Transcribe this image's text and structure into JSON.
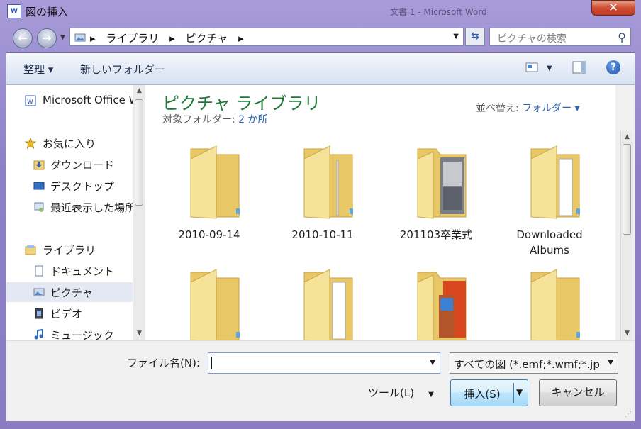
{
  "window": {
    "title": "図の挿入",
    "background_title": "文書 1 - Microsoft Word",
    "close_label": "✕"
  },
  "address": {
    "crumbs": [
      "ライブラリ",
      "ピクチャ"
    ],
    "search_placeholder": "ピクチャの検索"
  },
  "toolbar": {
    "organize_label": "整理 ▾",
    "new_folder_label": "新しいフォルダー"
  },
  "nav": {
    "items": [
      {
        "label": "Microsoft Office W",
        "icon": "word-doc-icon"
      },
      {
        "label": "お気に入り",
        "icon": "star-icon"
      },
      {
        "label": "ダウンロード",
        "icon": "download-folder-icon"
      },
      {
        "label": "デスクトップ",
        "icon": "desktop-icon"
      },
      {
        "label": "最近表示した場所",
        "icon": "recent-places-icon"
      },
      {
        "label": "ライブラリ",
        "icon": "library-icon"
      },
      {
        "label": "ドキュメント",
        "icon": "documents-icon"
      },
      {
        "label": "ピクチャ",
        "icon": "pictures-icon"
      },
      {
        "label": "ビデオ",
        "icon": "videos-icon"
      },
      {
        "label": "ミュージック",
        "icon": "music-icon"
      }
    ]
  },
  "content": {
    "library_title": "ピクチャ ライブラリ",
    "target_label": "対象フォルダー: ",
    "target_value": "2 か所",
    "arrange_label": "並べ替え: ",
    "arrange_value": "フォルダー ▾",
    "folders": [
      {
        "name": "2010-09-14"
      },
      {
        "name": "2010-10-11"
      },
      {
        "name": "201103卒業式"
      },
      {
        "name": "Downloaded Albums"
      },
      {
        "name": ""
      },
      {
        "name": ""
      },
      {
        "name": ""
      },
      {
        "name": ""
      }
    ]
  },
  "bottom": {
    "filename_label": "ファイル名(N):",
    "filename_value": "",
    "filter_value": "すべての図 (*.emf;*.wmf;*.jp",
    "tools_label": "ツール(L)",
    "insert_label": "挿入(S)",
    "cancel_label": "キャンセル"
  }
}
